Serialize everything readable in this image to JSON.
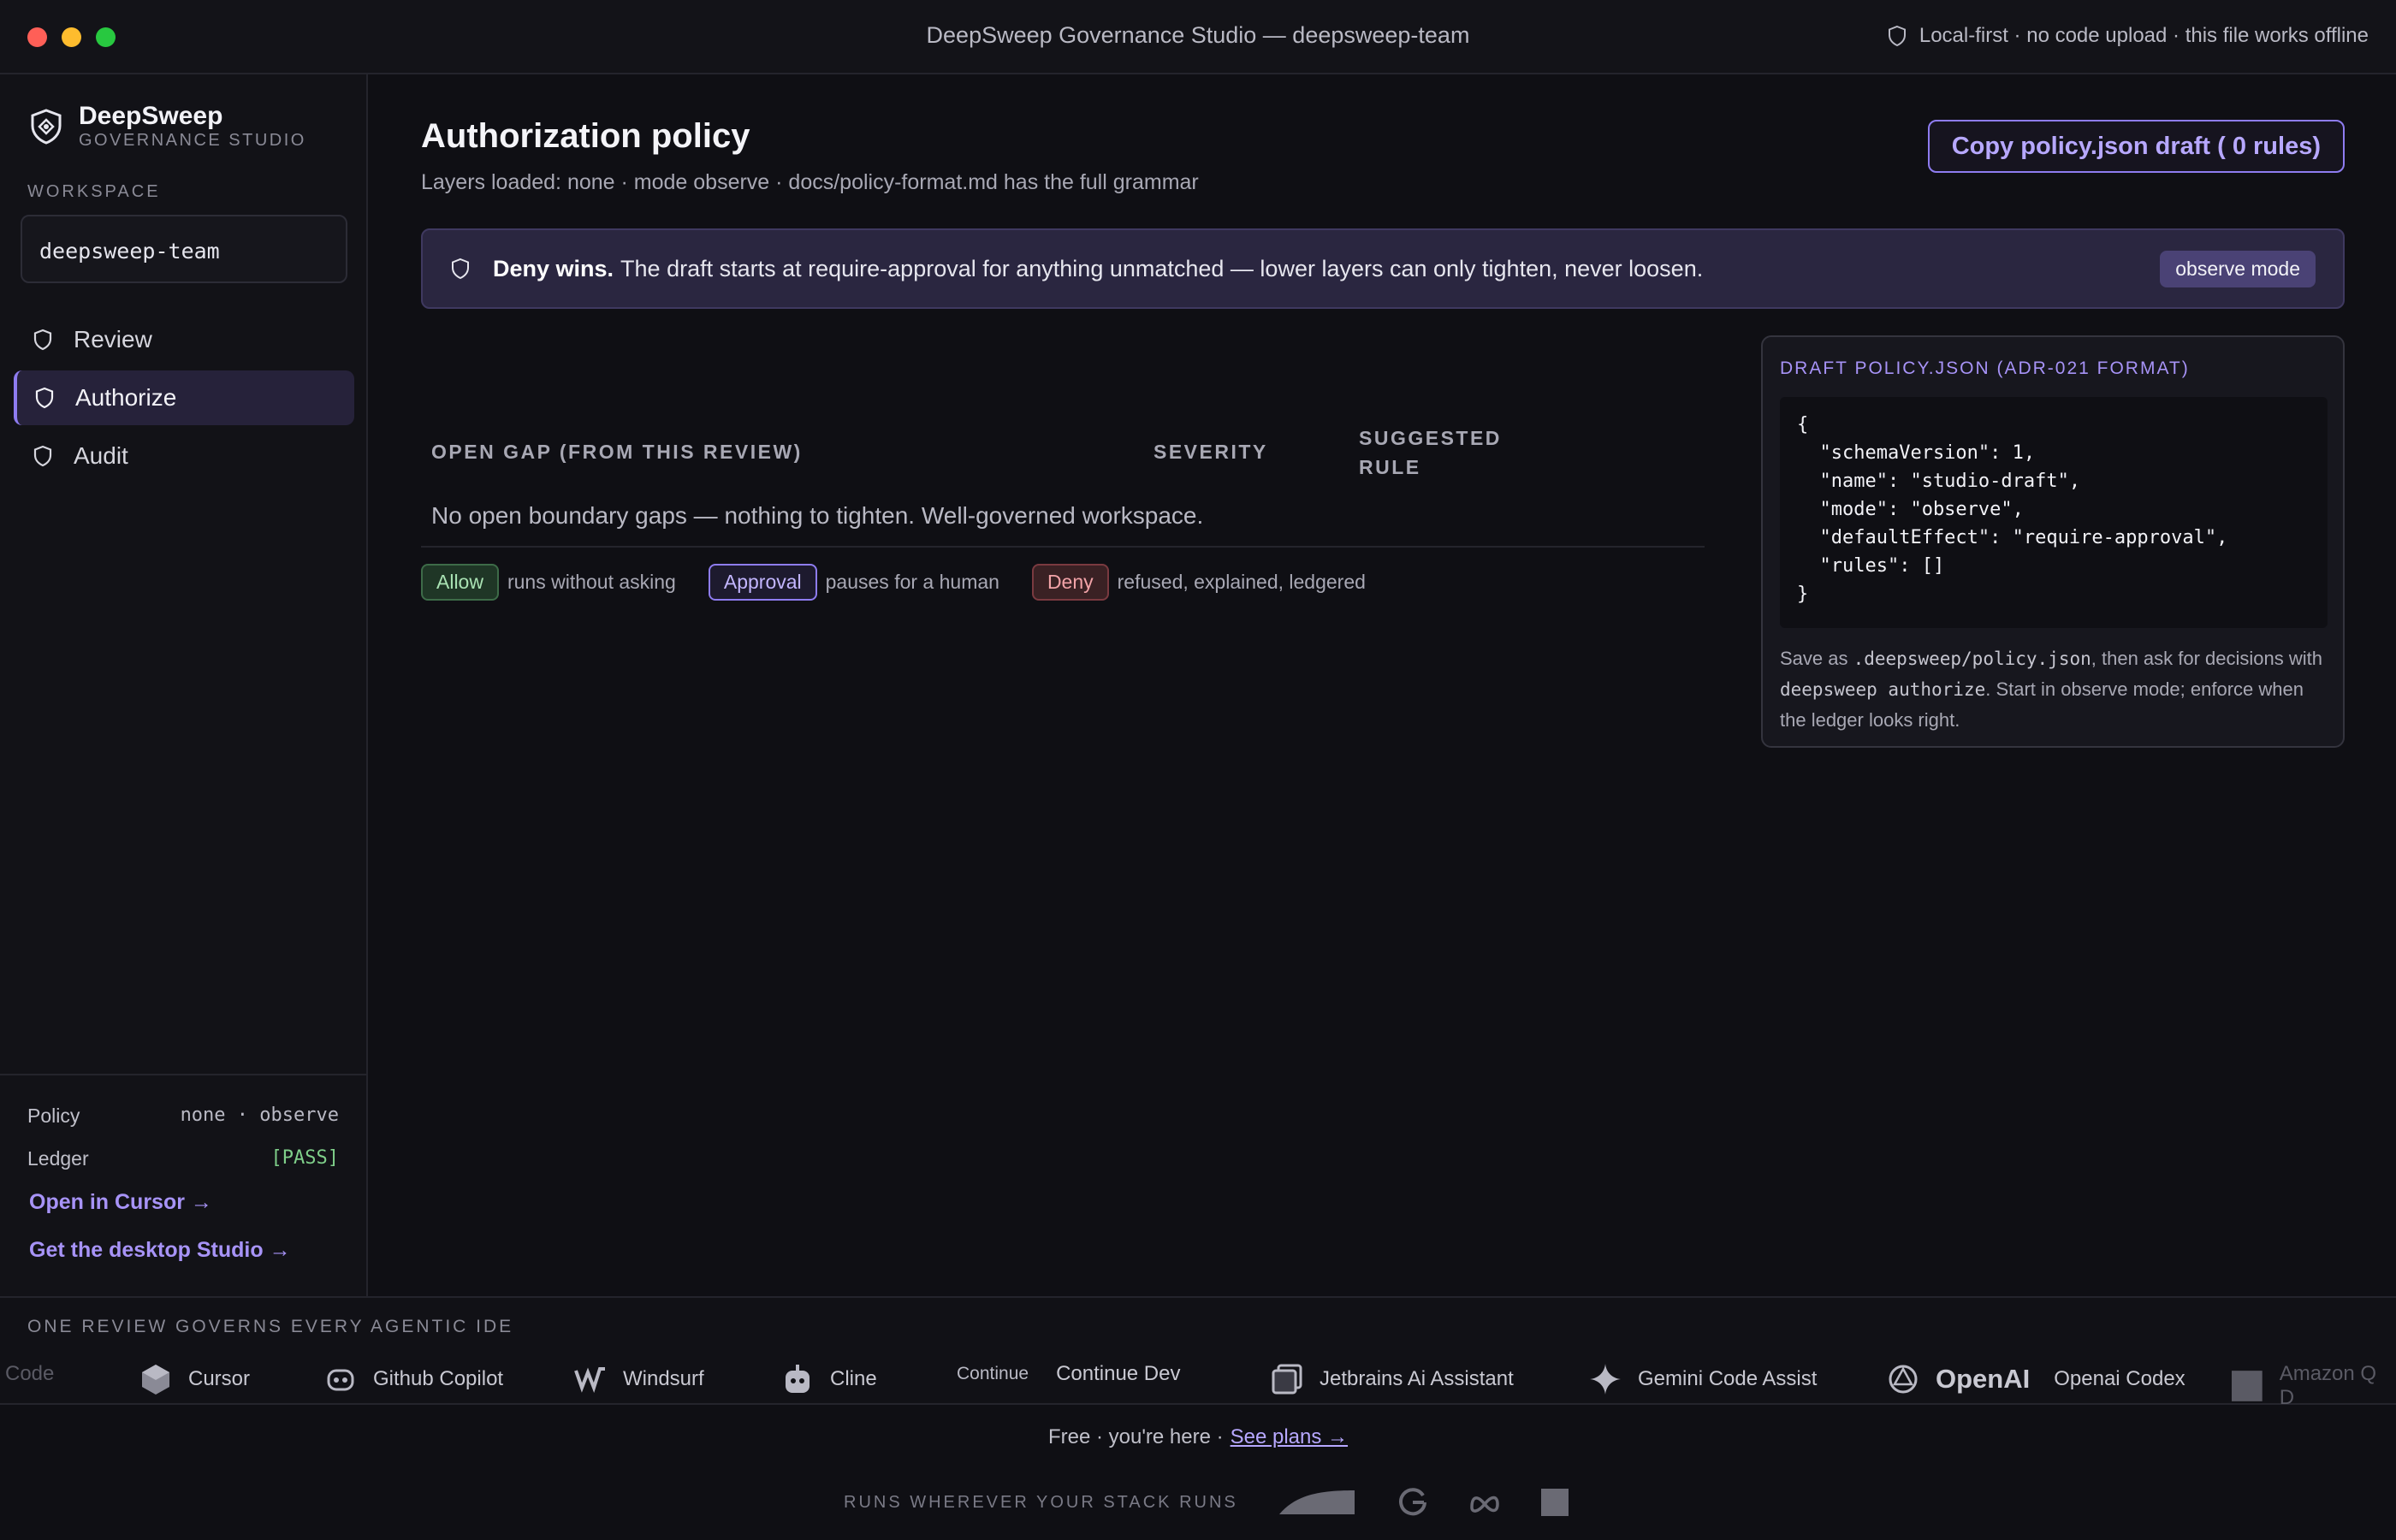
{
  "window": {
    "title": "DeepSweep Governance Studio — deepsweep-team",
    "offline_note": "Local-first · no code upload · this file works offline"
  },
  "sidebar": {
    "brand_name": "DeepSweep",
    "brand_sub": "GOVERNANCE STUDIO",
    "workspace_label": "WORKSPACE",
    "workspace_value": "deepsweep-team",
    "nav": [
      {
        "label": "Review",
        "icon": "shield-icon",
        "active": false
      },
      {
        "label": "Authorize",
        "icon": "shield-icon",
        "active": true
      },
      {
        "label": "Audit",
        "icon": "shield-icon",
        "active": false
      }
    ],
    "policy_label": "Policy",
    "policy_value": "none · observe",
    "ledger_label": "Ledger",
    "ledger_value": "[PASS]",
    "open_cursor": "Open in Cursor →",
    "desktop_link": "Get the desktop Studio →"
  },
  "main": {
    "title": "Authorization policy",
    "subtitle": "Layers loaded: none · mode observe · docs/policy-format.md has the full grammar",
    "copy_button": "Copy policy.json draft ( 0 rules)",
    "banner": {
      "bold": "Deny wins.",
      "text": "The draft starts at require-approval for anything unmatched — lower layers can only tighten, never loosen.",
      "mode_pill": "observe mode"
    },
    "table": {
      "col_gap": "OPEN GAP (FROM THIS REVIEW)",
      "col_severity": "SEVERITY",
      "col_rule_1": "SUGGESTED",
      "col_rule_2": "RULE",
      "empty_message": "No open boundary gaps — nothing to tighten. Well-governed workspace."
    },
    "legend": {
      "allow": "Allow",
      "allow_desc": "runs without asking",
      "approval": "Approval",
      "approval_desc": "pauses for a human",
      "deny": "Deny",
      "deny_desc": "refused, explained, ledgered"
    },
    "draft": {
      "title": "DRAFT POLICY.JSON (ADR-021 FORMAT)",
      "code": "{\n  \"schemaVersion\": 1,\n  \"name\": \"studio-draft\",\n  \"mode\": \"observe\",\n  \"defaultEffect\": \"require-approval\",\n  \"rules\": []\n}",
      "note_1": "Save as ",
      "note_path": ".deepsweep/policy.json",
      "note_2": ", then ask for decisions with ",
      "note_cmd": "deepsweep authorize",
      "note_3": ". Start in observe mode; enforce when the ledger looks right."
    }
  },
  "ide_strip": {
    "label": "ONE REVIEW GOVERNS EVERY AGENTIC IDE",
    "items": [
      "Code",
      "Cursor",
      "Github Copilot",
      "Windsurf",
      "Cline",
      "Continue Dev",
      "Jetbrains Ai Assistant",
      "Gemini Code Assist",
      "Openai Codex",
      "Amazon Q D"
    ],
    "continue_logo": "Continue",
    "openai_logo": "OpenAI"
  },
  "footer": {
    "plan_text": "Free · you're here ·",
    "plan_link": "See plans →",
    "stack_label": "RUNS WHEREVER YOUR STACK RUNS"
  },
  "colors": {
    "accent": "#8e7cf0",
    "pass": "#7fcf8a",
    "deny": "#f2a3a8",
    "allow": "#a9e2b3"
  }
}
